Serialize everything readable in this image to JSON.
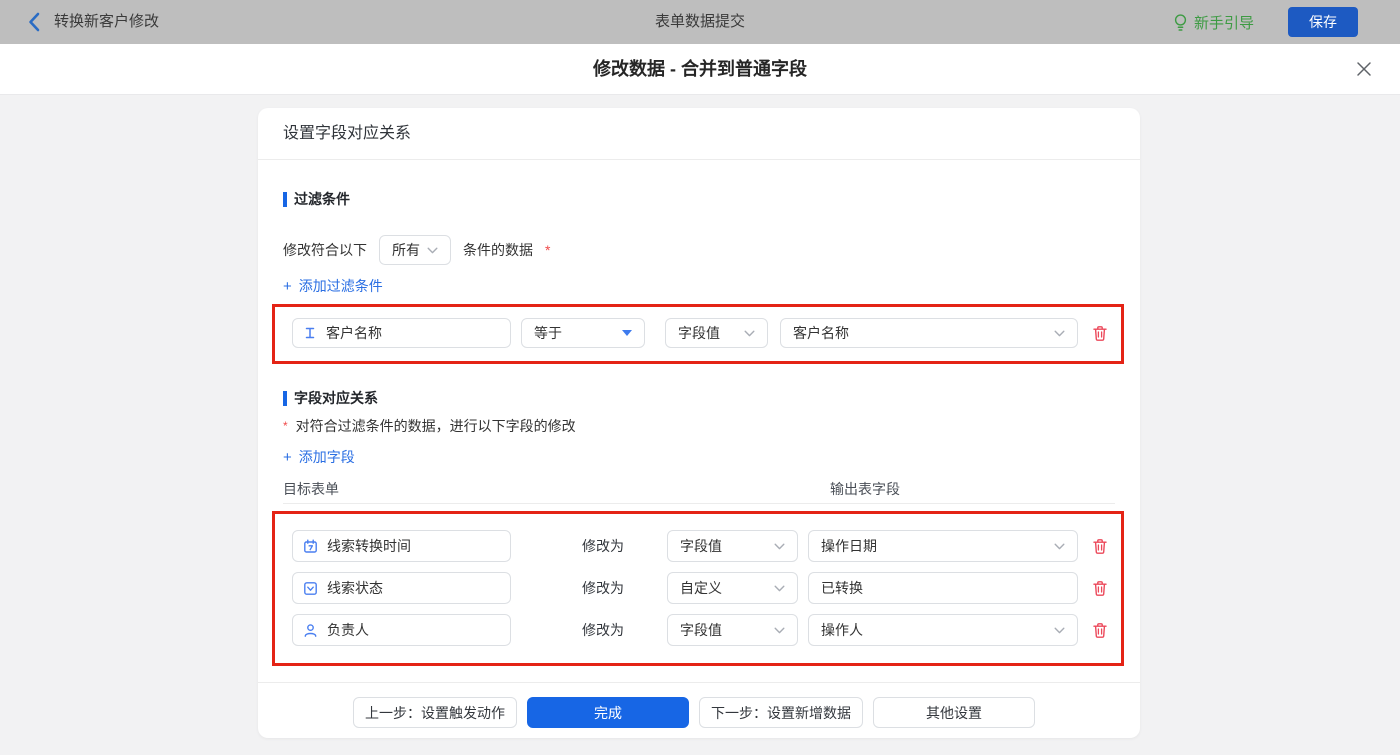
{
  "top_bar": {
    "back_label": "转换新客户修改",
    "center_title": "表单数据提交",
    "guide_label": "新手引导",
    "save_label": "保存"
  },
  "modal": {
    "title": "修改数据 - 合并到普通字段"
  },
  "panel": {
    "header": "设置字段对应关系",
    "filter": {
      "title": "过滤条件",
      "match_prefix": "修改符合以下",
      "match_value": "所有",
      "match_suffix": "条件的数据",
      "required_mark": "*",
      "add_plus": "+",
      "add_label": "添加过滤条件",
      "row": {
        "field": "客户名称",
        "operator": "等于",
        "value_type": "字段值",
        "value": "客户名称"
      }
    },
    "mapping": {
      "title": "字段对应关系",
      "required_mark": "*",
      "description": "对符合过滤条件的数据，进行以下字段的修改",
      "add_plus": "+",
      "add_label": "添加字段",
      "col_target": "目标表单",
      "col_output": "输出表字段",
      "rows": [
        {
          "field": "线索转换时间",
          "modify_label": "修改为",
          "value_type": "字段值",
          "value": "操作日期"
        },
        {
          "field": "线索状态",
          "modify_label": "修改为",
          "value_type": "自定义",
          "value": "已转换"
        },
        {
          "field": "负责人",
          "modify_label": "修改为",
          "value_type": "字段值",
          "value": "操作人"
        }
      ]
    },
    "footer": {
      "prev_label": "上一步：设置触发动作",
      "done_label": "完成",
      "next_label": "下一步：设置新增数据",
      "other_label": "其他设置"
    }
  },
  "colors": {
    "accent_blue": "#1766e5",
    "link_blue": "#2b6fe3",
    "annotation_red": "#e42315",
    "danger_red": "#ec485a",
    "guide_green": "#3d9b43",
    "field_icon_blue": "#4a7ff0"
  }
}
